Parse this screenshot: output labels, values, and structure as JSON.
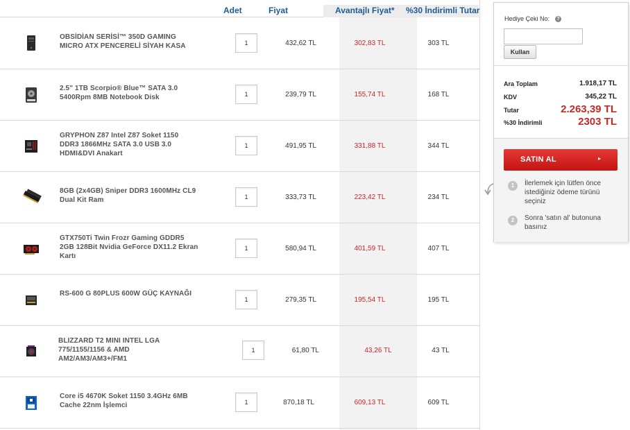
{
  "table": {
    "headers": {
      "qty": "Adet",
      "price": "Fiyat",
      "advantage": "Avantajlı Fiyat*",
      "discount": "%30 İndirimli Tutar"
    },
    "rows": [
      {
        "name": "OBSİDİAN SERİSİ™ 350D GAMING MICRO ATX PENCERELİ SİYAH KASA",
        "qty": "1",
        "price": "432,62 TL",
        "advantage_price": "302,83 TL",
        "discounted": "303 TL",
        "icon": "pc-case-icon"
      },
      {
        "name": "2.5\" 1TB Scorpio® Blue™ SATA 3.0 5400Rpm 8MB Notebook Disk",
        "qty": "1",
        "price": "239,79 TL",
        "advantage_price": "155,74 TL",
        "discounted": "168 TL",
        "icon": "hard-disk-icon"
      },
      {
        "name": "GRYPHON Z87 Intel Z87 Soket 1150 DDR3 1866MHz SATA 3.0 USB 3.0 HDMI&DVI Anakart",
        "qty": "1",
        "price": "491,95 TL",
        "advantage_price": "331,88 TL",
        "discounted": "344 TL",
        "icon": "motherboard-icon"
      },
      {
        "name": "8GB (2x4GB) Sniper DDR3 1600MHz CL9 Dual Kit Ram",
        "qty": "1",
        "price": "333,73 TL",
        "advantage_price": "223,42 TL",
        "discounted": "234 TL",
        "icon": "ram-icon"
      },
      {
        "name": "GTX750Ti Twin Frozr Gaming GDDR5 2GB 128Bit Nvidia GeForce DX11.2 Ekran Kartı",
        "qty": "1",
        "price": "580,94 TL",
        "advantage_price": "401,59 TL",
        "discounted": "407 TL",
        "icon": "graphics-card-icon"
      },
      {
        "name": "RS-600 G 80PLUS 600W GÜÇ KAYNAĞI",
        "qty": "1",
        "price": "279,35 TL",
        "advantage_price": "195,54 TL",
        "discounted": "195 TL",
        "icon": "power-supply-icon"
      },
      {
        "name": "BLIZZARD T2 MINI INTEL LGA 775/1155/1156 & AMD AM2/AM3/AM3+/FM1",
        "qty": "1",
        "price": "61,80 TL",
        "advantage_price": "43,26 TL",
        "discounted": "43 TL",
        "icon": "cpu-cooler-icon"
      },
      {
        "name": "Core i5 4670K Soket 1150 3.4GHz 6MB Cache 22nm İşlemci",
        "qty": "1",
        "price": "870,18 TL",
        "advantage_price": "609,13 TL",
        "discounted": "609 TL",
        "icon": "processor-icon"
      }
    ]
  },
  "panel": {
    "gift_label": "Hediye Çeki No:",
    "help_symbol": "?",
    "gift_value": "",
    "use_button": "Kullan",
    "subtotal_label": "Ara Toplam",
    "subtotal_value": "1.918,17 TL",
    "vat_label": "KDV",
    "vat_value": "345,22 TL",
    "total_label": "Tutar",
    "total_value": "2.263,39 TL",
    "discounted_label": "%30 İndirimli",
    "discounted_value": "2303 TL",
    "buy_button": "SATIN AL",
    "buy_arrow": "▸",
    "steps": [
      {
        "num": "1",
        "text": "İlerlemek için lütfen önce istediğiniz ödeme türünü seçiniz"
      },
      {
        "num": "2",
        "text": "Sonra 'satın al' butonuna basınız"
      }
    ]
  },
  "colors": {
    "header_blue": "#1e5a96",
    "price_red": "#c62828",
    "button_red": "#d32020"
  }
}
